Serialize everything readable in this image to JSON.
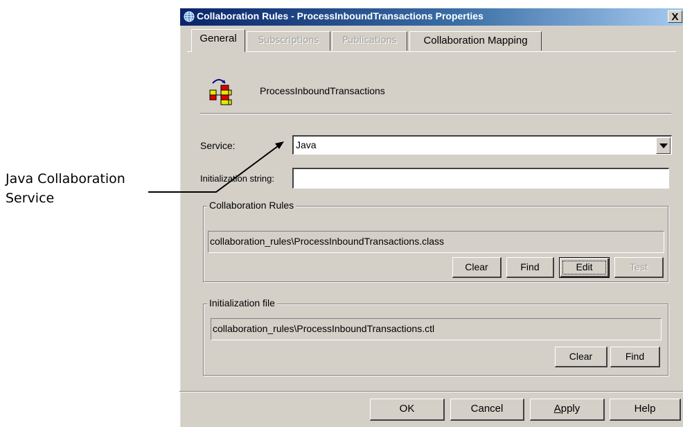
{
  "callout": {
    "line1": "Java Collaboration",
    "line2": "Service"
  },
  "window": {
    "title": "Collaboration Rules - ProcessInboundTransactions Properties",
    "close_label": "X"
  },
  "tabs": [
    {
      "label": "General",
      "active": true
    },
    {
      "label": "Subscriptions",
      "enabled": false
    },
    {
      "label": "Publications",
      "enabled": false
    },
    {
      "label": "Collaboration Mapping",
      "enabled": true
    }
  ],
  "general": {
    "name": "ProcessInboundTransactions",
    "service_label": "Service:",
    "service_value": "Java",
    "init_string_label": "Initialization string:",
    "init_string_value": ""
  },
  "collab_rules": {
    "title": "Collaboration Rules",
    "path": "collaboration_rules\\ProcessInboundTransactions.class",
    "buttons": {
      "clear": "Clear",
      "find": "Find",
      "edit": "Edit",
      "test": "Test"
    }
  },
  "init_file": {
    "title": "Initialization file",
    "path": "collaboration_rules\\ProcessInboundTransactions.ctl",
    "buttons": {
      "clear": "Clear",
      "find": "Find"
    }
  },
  "dialog_buttons": {
    "ok": "OK",
    "cancel": "Cancel",
    "apply_mnemonic": "A",
    "apply_rest": "pply",
    "help": "Help"
  }
}
